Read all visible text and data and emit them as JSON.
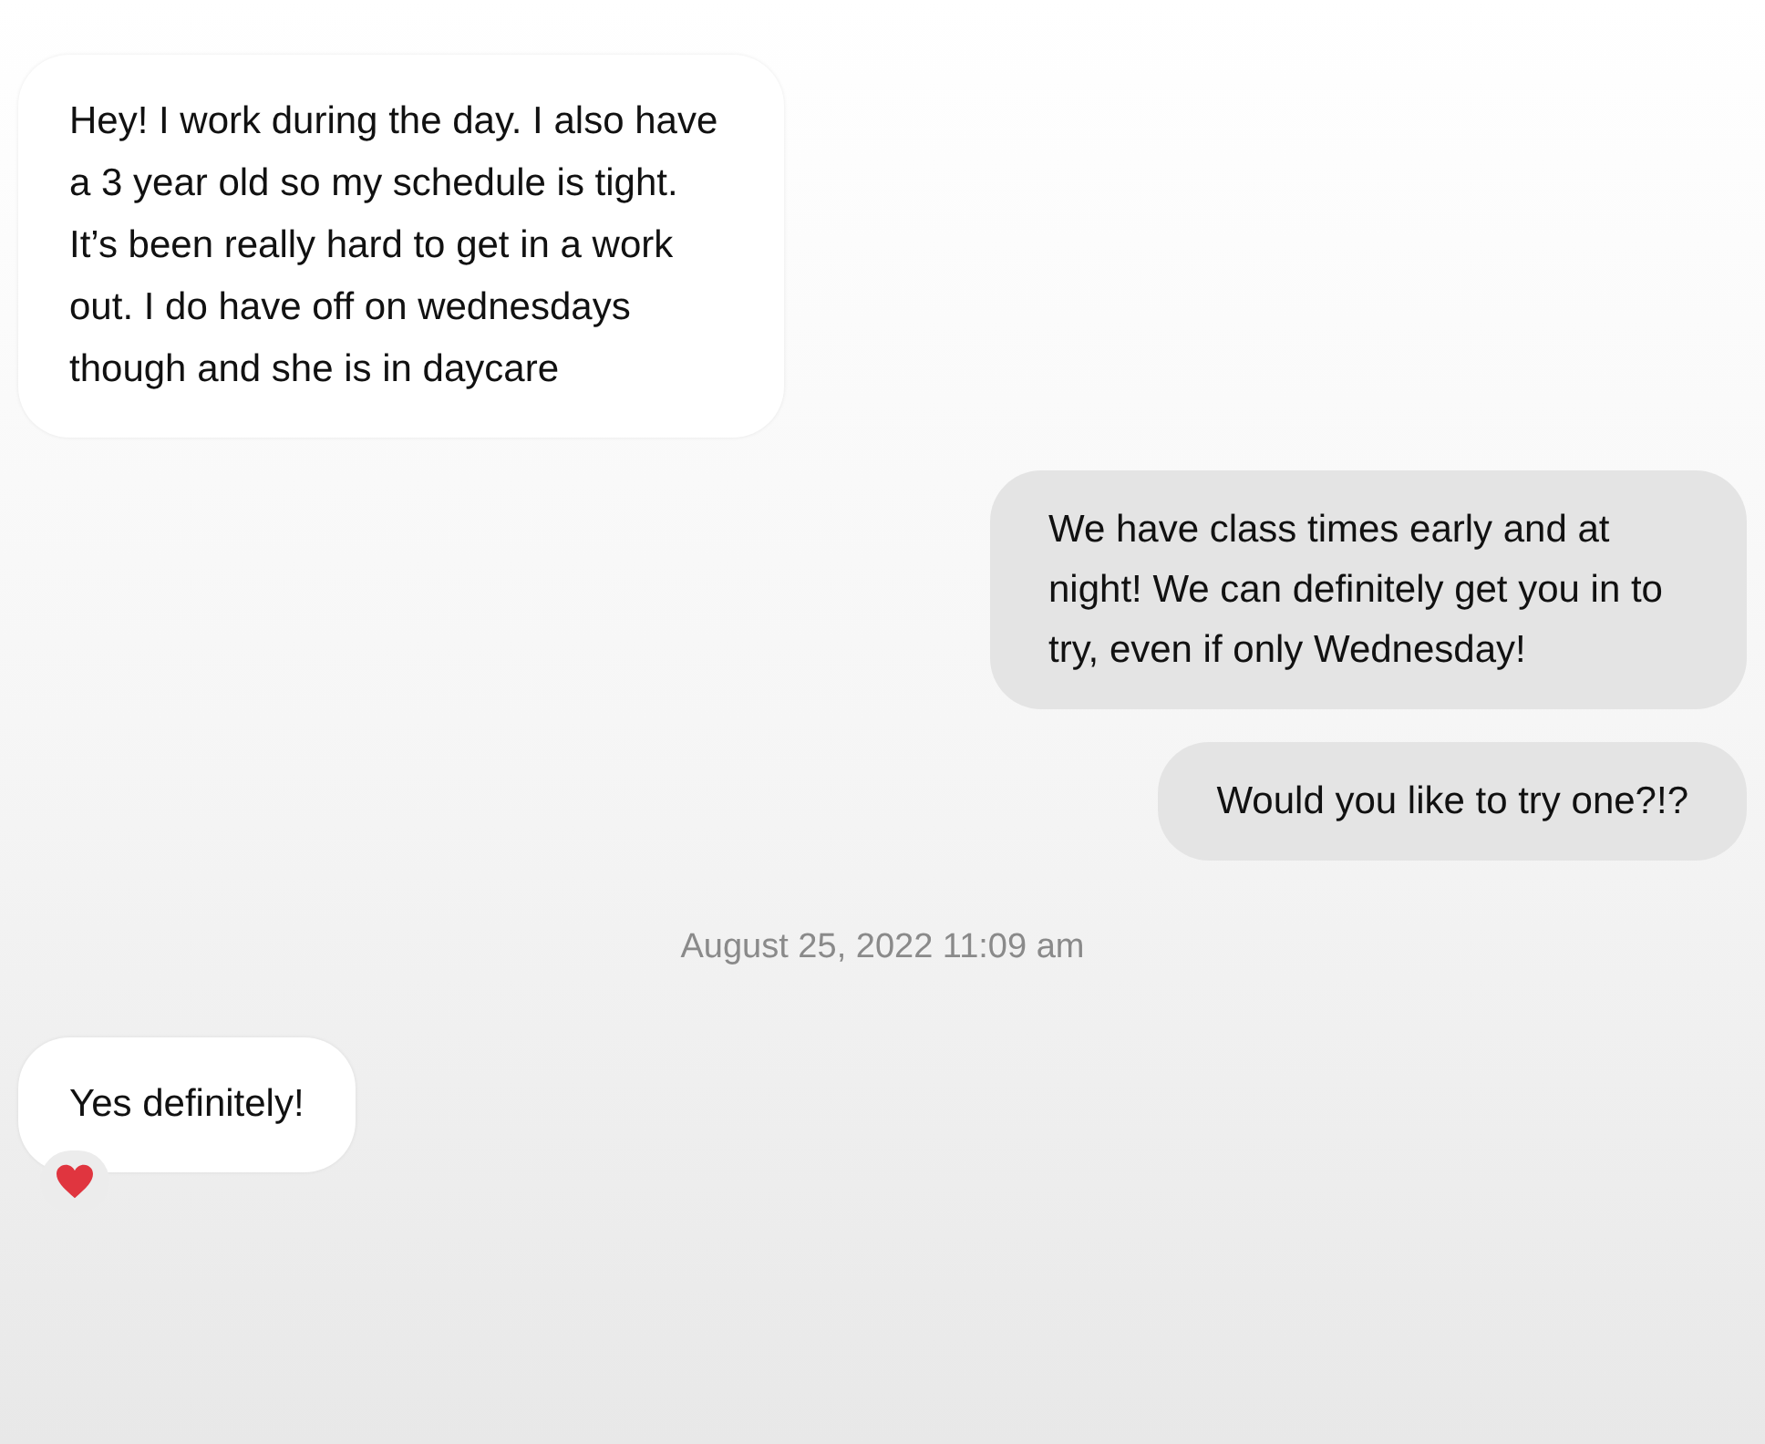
{
  "messages": [
    {
      "kind": "incoming",
      "text": "Hey! I work during the day. I also have a 3 year old so my schedule is tight. It’s been really hard to get in a work out. I do have off on wednesdays though and she is in daycare"
    },
    {
      "kind": "outgoing",
      "text": "We have class times early and at night! We can definitely get you in to try, even if only Wednesday!"
    },
    {
      "kind": "outgoing",
      "text": "Would you like to try one?!?"
    },
    {
      "kind": "timestamp",
      "text": "August 25, 2022 11:09 am"
    },
    {
      "kind": "incoming",
      "text": "Yes definitely!",
      "heart_reaction": true
    }
  ]
}
